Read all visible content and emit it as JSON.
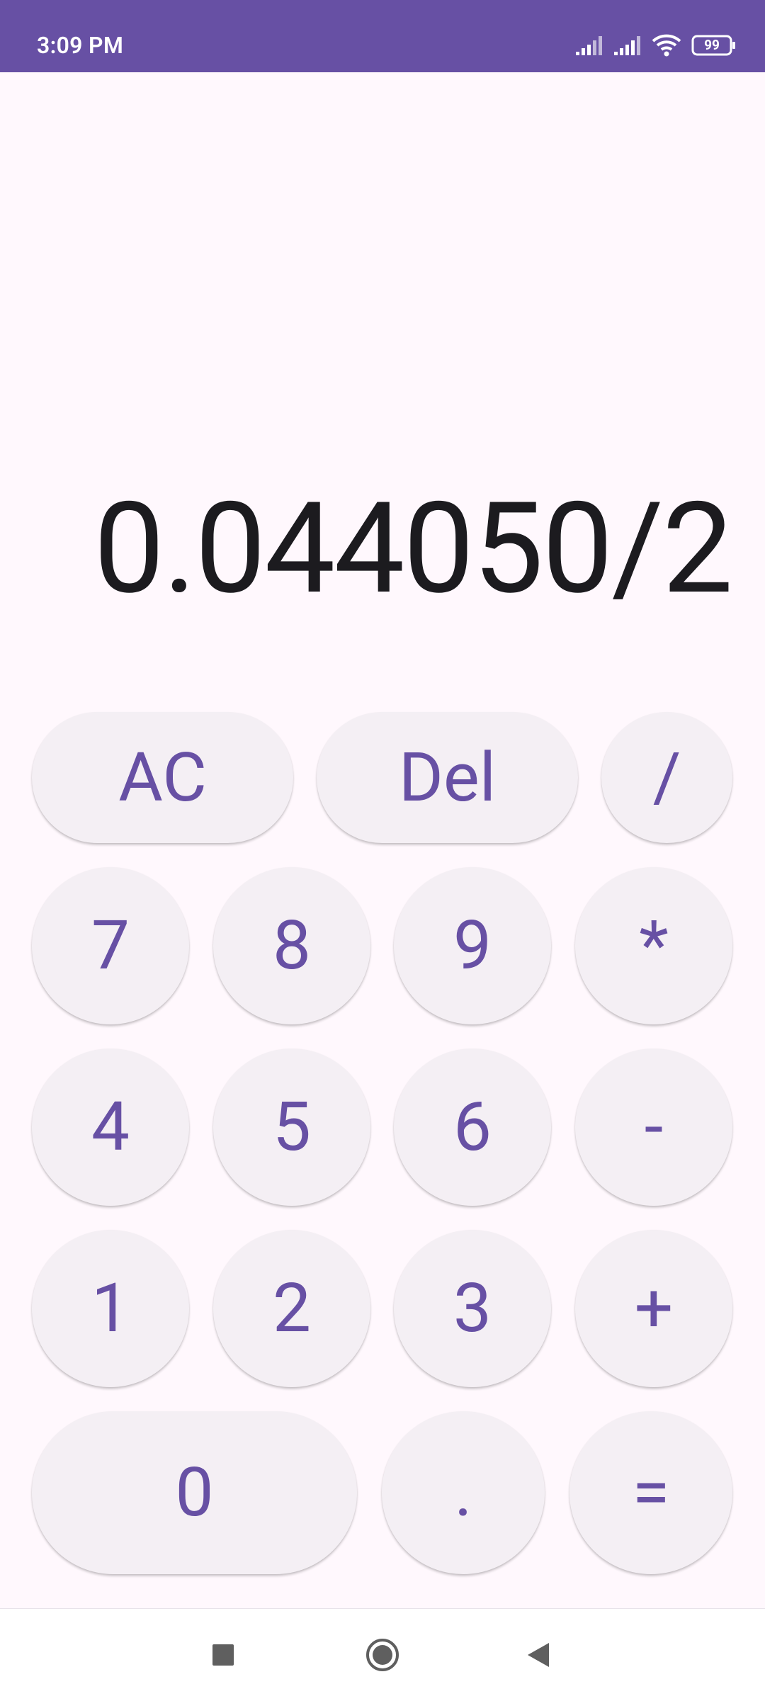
{
  "status_bar": {
    "time": "3:09 PM",
    "battery": "99",
    "icons": [
      "signal-icon",
      "signal-icon",
      "wifi-icon",
      "battery-icon"
    ]
  },
  "display": {
    "expression": "0.044050/2"
  },
  "keys": {
    "ac": "AC",
    "del": "Del",
    "divide": "/",
    "seven": "7",
    "eight": "8",
    "nine": "9",
    "multiply": "*",
    "four": "4",
    "five": "5",
    "six": "6",
    "minus": "-",
    "one": "1",
    "two": "2",
    "three": "3",
    "plus": "+",
    "zero": "0",
    "dot": ".",
    "equals": "="
  },
  "colors": {
    "accent": "#6750A4",
    "key_bg": "#F4EFF4",
    "background": "#FFF8FD",
    "display_text": "#1C1B1F"
  },
  "nav_bar": {
    "icons": [
      "recents-square-icon",
      "home-circle-icon",
      "back-triangle-icon"
    ]
  }
}
